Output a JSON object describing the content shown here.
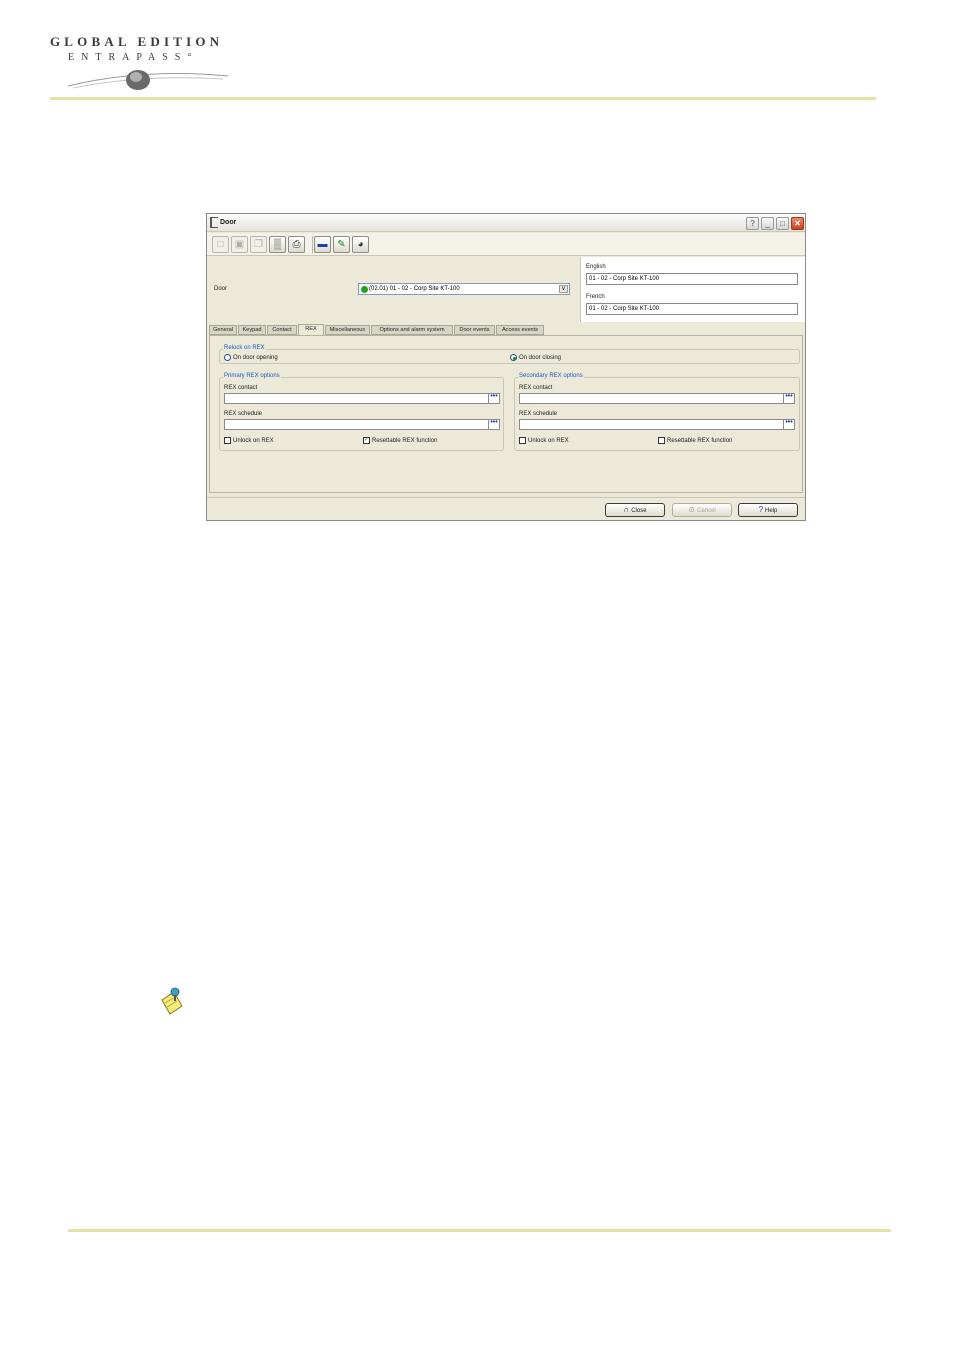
{
  "header": {
    "logo_line1": "GLOBAL EDITION",
    "logo_line2": "ENTRAPASS°"
  },
  "window": {
    "title": "Door",
    "title_buttons": [
      "?",
      "_",
      "□",
      "✕"
    ],
    "toolbar": {
      "icons": [
        "new-icon",
        "save-icon",
        "copy-icon",
        "delete-icon",
        "print-icon",
        "link-icon",
        "edit-icon",
        "find-icon"
      ]
    },
    "door": {
      "label": "Door",
      "selected": "(02.01) 01 - 02 - Corp Site KT-100",
      "dropdown_arrow": "∨"
    },
    "languages": {
      "english_label": "English",
      "english_value": "01 - 02 - Corp Site KT-100",
      "french_label": "French",
      "french_value": "01 - 02 - Corp Site KT-100"
    },
    "tabs": [
      "General",
      "Keypad",
      "Contact",
      "REX",
      "Miscellaneous",
      "Options and alarm system",
      "Door events",
      "Access events"
    ],
    "active_tab": "REX",
    "rex": {
      "relock_title": "Relock on REX",
      "on_door_opening": "On door opening",
      "on_door_closing": "On door closing",
      "primary": {
        "title": "Primary REX options",
        "contact_label": "REX contact",
        "contact_value": "",
        "schedule_label": "REX schedule",
        "schedule_value": "",
        "unlock_label": "Unlock on REX",
        "unlock_checked": false,
        "resettable_label": "Resettable REX function",
        "resettable_checked": true
      },
      "secondary": {
        "title": "Secondary REX options",
        "contact_label": "REX contact",
        "contact_value": "",
        "schedule_label": "REX schedule",
        "schedule_value": "",
        "unlock_label": "Unlock on REX",
        "unlock_checked": false,
        "resettable_label": "Resettable REX function",
        "resettable_checked": false
      },
      "browse_label": "•••"
    },
    "buttons": {
      "close": "Close",
      "cancel": "Cancel",
      "help": "Help"
    }
  },
  "colors": {
    "accent_rule": "#e6e1a6",
    "group_title": "#1f5ac4",
    "window_bg": "#ece9d8"
  }
}
